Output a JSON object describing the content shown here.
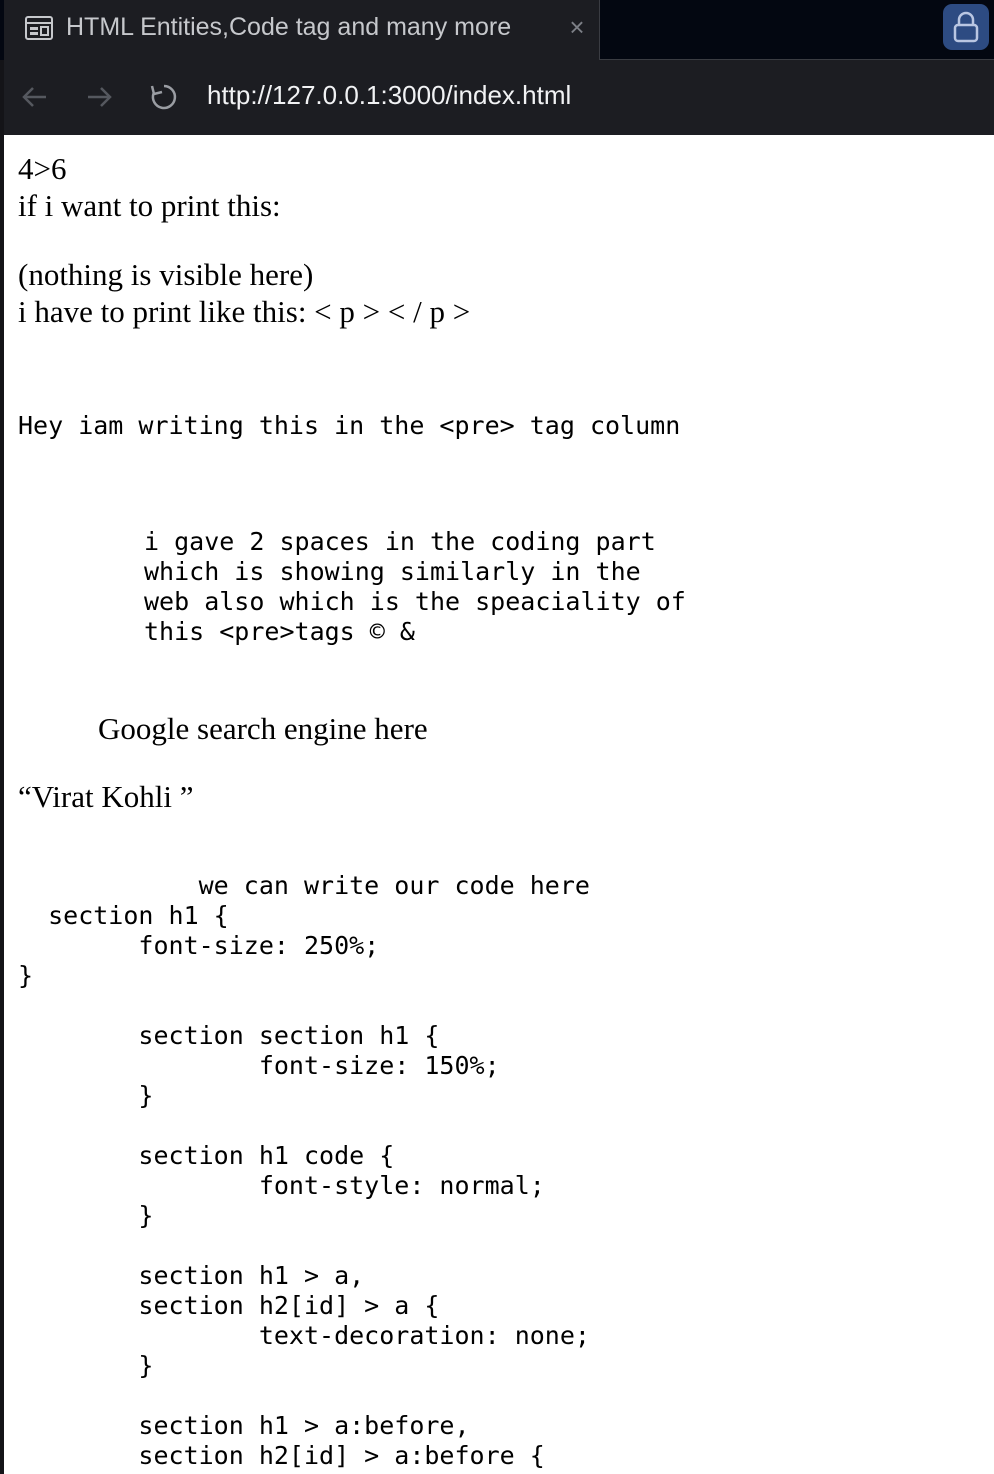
{
  "browser": {
    "tab_title": "HTML Entities,Code tag and many more",
    "tab_icon": "page-layout-icon",
    "close_icon": "close-icon",
    "lock_icon": "lock-icon",
    "url": "http://127.0.0.1:3000/index.html",
    "nav_icons": [
      "back-arrow-icon",
      "forward-arrow-icon",
      "reload-icon"
    ]
  },
  "page": {
    "entities": {
      "line1": "4>6",
      "line2": "if i want to print this:",
      "line3": "(nothing is visible here)",
      "line4": "i have to print like this: < p > < / p >"
    },
    "pre1": "Hey iam writing this in the <pre> tag column",
    "pre2": [
      "i gave 2 spaces in the coding part",
      "which is showing similarly in the",
      "web also which is the speaciality of",
      "this <pre>tags © &"
    ],
    "google_text": "Google search engine here",
    "quote": "“Virat Kohli ”",
    "code_lines": [
      "            we can write our code here",
      "  section h1 {",
      "        font-size: 250%;",
      "}",
      "",
      "        section section h1 {",
      "                font-size: 150%;",
      "        }",
      "",
      "        section h1 code {",
      "                font-style: normal;",
      "        }",
      "",
      "        section h1 > a,",
      "        section h2[id] > a {",
      "                text-decoration: none;",
      "        }",
      "",
      "        section h1 > a:before,",
      "        section h2[id] > a:before {"
    ]
  }
}
